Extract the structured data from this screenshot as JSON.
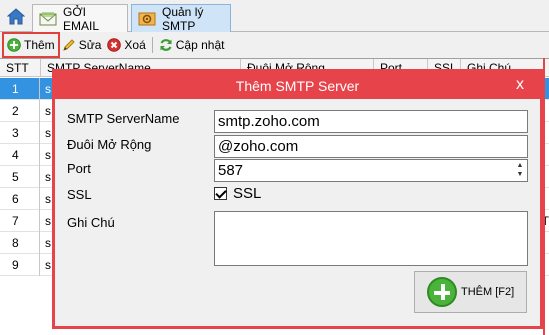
{
  "tabs": {
    "home_icon": "home-icon",
    "send_email": "GỞI EMAIL",
    "smtp_manage": "Quản lý SMTP"
  },
  "toolbar": {
    "add": "Thêm",
    "edit": "Sửa",
    "delete": "Xoá",
    "update": "Cập nhật"
  },
  "grid": {
    "headers": [
      "STT",
      "SMTP ServerName",
      "Đuôi Mở Rộng",
      "Port",
      "SSL",
      "Ghi Chú"
    ],
    "rows": [
      {
        "stt": "1",
        "c2": "s"
      },
      {
        "stt": "2",
        "c2": "s"
      },
      {
        "stt": "3",
        "c2": "s"
      },
      {
        "stt": "4",
        "c2": "s"
      },
      {
        "stt": "5",
        "c2": "s"
      },
      {
        "stt": "6",
        "c2": "s"
      },
      {
        "stt": "7",
        "c2": "s"
      },
      {
        "stt": "8",
        "c2": "s"
      },
      {
        "stt": "9",
        "c2": "s"
      }
    ],
    "right_edge_text": "ST",
    "selected_row": 0
  },
  "dialog": {
    "title": "Thêm SMTP Server",
    "close_glyph": "x",
    "labels": {
      "server": "SMTP ServerName",
      "ext": "Đuôi Mở Rộng",
      "port": "Port",
      "ssl": "SSL",
      "note": "Ghi Chú"
    },
    "values": {
      "server": "smtp.zoho.com",
      "ext": "@zoho.com",
      "port": "587",
      "ssl_label": "SSL",
      "ssl_checked": true,
      "note": ""
    },
    "add_button": "THÊM [F2]"
  },
  "colors": {
    "accent_red": "#e7434a",
    "selection_blue": "#3393e0",
    "add_green": "#4ab33a"
  }
}
